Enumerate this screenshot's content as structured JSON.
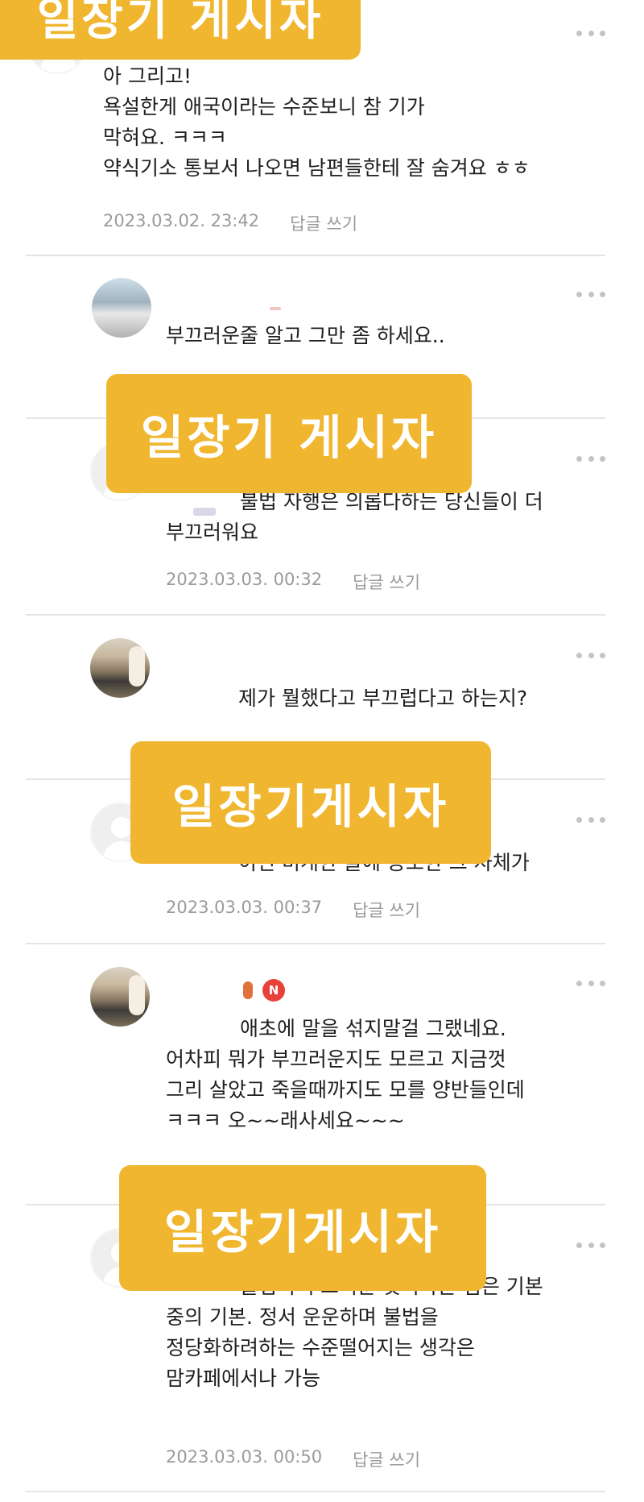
{
  "banner_text": "일장기 게시자",
  "banner_text_compact": "일장기게시자",
  "more_icon": "more-horizontal-icon",
  "reply_label": "답글 쓰기",
  "new_badge": "N",
  "comments": [
    {
      "lines": [
        "아 그리고!",
        "욕설한게 애국이라는 수준보니 참 기가",
        "막혀요. ㅋㅋㅋ",
        "약식기소 통보서 나오면 남편들한테 잘 숨겨요 ㅎㅎ"
      ],
      "timestamp": "2023.03.02. 23:42"
    },
    {
      "lines": [
        "부끄러운줄 알고 그만 좀 하세요.."
      ]
    },
    {
      "lines": [
        "불법 자행은 의롭다하는 당신들이 더",
        "부끄러워요"
      ],
      "timestamp": "2023.03.03. 00:32"
    },
    {
      "lines": [
        "제가 뭘했다고 부끄럽다고 하는지?"
      ]
    },
    {
      "lines": [
        "이런 미개한 글에 동조한 그 자체가"
      ],
      "timestamp": "2023.03.03. 00:37"
    },
    {
      "lines": [
        "애초에 말을 섞지말걸 그랬네요.",
        "어차피 뭐가 부끄러운지도 모르고 지금껏",
        "그리 살았고 죽을때까지도 모를 양반들인데",
        "ㅋㅋㅋ 오~~래사세요~~~"
      ]
    },
    {
      "lines": [
        "불법이 부끄러운 것이라는 점은 기본",
        "중의 기본. 정서 운운하며 불법을",
        "정당화하려하는 수준떨어지는 생각은",
        "맘카페에서나 가능"
      ],
      "timestamp": "2023.03.03. 00:50"
    }
  ]
}
